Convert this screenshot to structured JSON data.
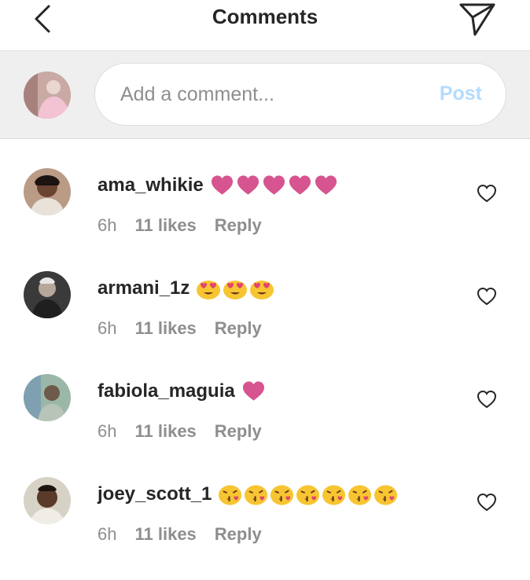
{
  "header": {
    "title": "Comments",
    "back_icon": "chevron-left-icon",
    "send_icon": "paper-plane-icon"
  },
  "composer": {
    "placeholder": "Add a comment...",
    "post_label": "Post",
    "post_color": "#b3dbff"
  },
  "comments": [
    {
      "username": "ama_whikie",
      "emoji": "heart",
      "emoji_count": 5,
      "time": "6h",
      "likes": "11 likes",
      "reply": "Reply"
    },
    {
      "username": "armani_1z",
      "emoji": "heart-eyes",
      "emoji_count": 3,
      "time": "6h",
      "likes": "11 likes",
      "reply": "Reply"
    },
    {
      "username": "fabiola_maguia",
      "emoji": "heart",
      "emoji_count": 1,
      "time": "6h",
      "likes": "11 likes",
      "reply": "Reply"
    },
    {
      "username": "joey_scott_1",
      "emoji": "kiss",
      "emoji_count": 7,
      "time": "6h",
      "likes": "11 likes",
      "reply": "Reply"
    }
  ],
  "colors": {
    "heart_emoji": "#d6548f",
    "text_primary": "#262626",
    "text_secondary": "#8e8e8e",
    "composer_bg": "#efefef"
  }
}
